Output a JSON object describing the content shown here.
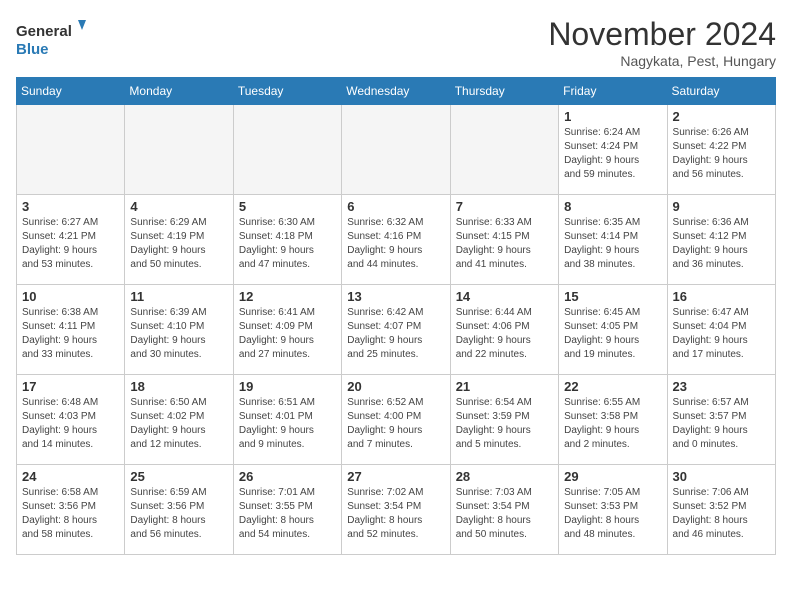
{
  "logo": {
    "line1": "General",
    "line2": "Blue"
  },
  "title": "November 2024",
  "subtitle": "Nagykata, Pest, Hungary",
  "days_of_week": [
    "Sunday",
    "Monday",
    "Tuesday",
    "Wednesday",
    "Thursday",
    "Friday",
    "Saturday"
  ],
  "weeks": [
    [
      {
        "day": "",
        "info": ""
      },
      {
        "day": "",
        "info": ""
      },
      {
        "day": "",
        "info": ""
      },
      {
        "day": "",
        "info": ""
      },
      {
        "day": "",
        "info": ""
      },
      {
        "day": "1",
        "info": "Sunrise: 6:24 AM\nSunset: 4:24 PM\nDaylight: 9 hours\nand 59 minutes."
      },
      {
        "day": "2",
        "info": "Sunrise: 6:26 AM\nSunset: 4:22 PM\nDaylight: 9 hours\nand 56 minutes."
      }
    ],
    [
      {
        "day": "3",
        "info": "Sunrise: 6:27 AM\nSunset: 4:21 PM\nDaylight: 9 hours\nand 53 minutes."
      },
      {
        "day": "4",
        "info": "Sunrise: 6:29 AM\nSunset: 4:19 PM\nDaylight: 9 hours\nand 50 minutes."
      },
      {
        "day": "5",
        "info": "Sunrise: 6:30 AM\nSunset: 4:18 PM\nDaylight: 9 hours\nand 47 minutes."
      },
      {
        "day": "6",
        "info": "Sunrise: 6:32 AM\nSunset: 4:16 PM\nDaylight: 9 hours\nand 44 minutes."
      },
      {
        "day": "7",
        "info": "Sunrise: 6:33 AM\nSunset: 4:15 PM\nDaylight: 9 hours\nand 41 minutes."
      },
      {
        "day": "8",
        "info": "Sunrise: 6:35 AM\nSunset: 4:14 PM\nDaylight: 9 hours\nand 38 minutes."
      },
      {
        "day": "9",
        "info": "Sunrise: 6:36 AM\nSunset: 4:12 PM\nDaylight: 9 hours\nand 36 minutes."
      }
    ],
    [
      {
        "day": "10",
        "info": "Sunrise: 6:38 AM\nSunset: 4:11 PM\nDaylight: 9 hours\nand 33 minutes."
      },
      {
        "day": "11",
        "info": "Sunrise: 6:39 AM\nSunset: 4:10 PM\nDaylight: 9 hours\nand 30 minutes."
      },
      {
        "day": "12",
        "info": "Sunrise: 6:41 AM\nSunset: 4:09 PM\nDaylight: 9 hours\nand 27 minutes."
      },
      {
        "day": "13",
        "info": "Sunrise: 6:42 AM\nSunset: 4:07 PM\nDaylight: 9 hours\nand 25 minutes."
      },
      {
        "day": "14",
        "info": "Sunrise: 6:44 AM\nSunset: 4:06 PM\nDaylight: 9 hours\nand 22 minutes."
      },
      {
        "day": "15",
        "info": "Sunrise: 6:45 AM\nSunset: 4:05 PM\nDaylight: 9 hours\nand 19 minutes."
      },
      {
        "day": "16",
        "info": "Sunrise: 6:47 AM\nSunset: 4:04 PM\nDaylight: 9 hours\nand 17 minutes."
      }
    ],
    [
      {
        "day": "17",
        "info": "Sunrise: 6:48 AM\nSunset: 4:03 PM\nDaylight: 9 hours\nand 14 minutes."
      },
      {
        "day": "18",
        "info": "Sunrise: 6:50 AM\nSunset: 4:02 PM\nDaylight: 9 hours\nand 12 minutes."
      },
      {
        "day": "19",
        "info": "Sunrise: 6:51 AM\nSunset: 4:01 PM\nDaylight: 9 hours\nand 9 minutes."
      },
      {
        "day": "20",
        "info": "Sunrise: 6:52 AM\nSunset: 4:00 PM\nDaylight: 9 hours\nand 7 minutes."
      },
      {
        "day": "21",
        "info": "Sunrise: 6:54 AM\nSunset: 3:59 PM\nDaylight: 9 hours\nand 5 minutes."
      },
      {
        "day": "22",
        "info": "Sunrise: 6:55 AM\nSunset: 3:58 PM\nDaylight: 9 hours\nand 2 minutes."
      },
      {
        "day": "23",
        "info": "Sunrise: 6:57 AM\nSunset: 3:57 PM\nDaylight: 9 hours\nand 0 minutes."
      }
    ],
    [
      {
        "day": "24",
        "info": "Sunrise: 6:58 AM\nSunset: 3:56 PM\nDaylight: 8 hours\nand 58 minutes."
      },
      {
        "day": "25",
        "info": "Sunrise: 6:59 AM\nSunset: 3:56 PM\nDaylight: 8 hours\nand 56 minutes."
      },
      {
        "day": "26",
        "info": "Sunrise: 7:01 AM\nSunset: 3:55 PM\nDaylight: 8 hours\nand 54 minutes."
      },
      {
        "day": "27",
        "info": "Sunrise: 7:02 AM\nSunset: 3:54 PM\nDaylight: 8 hours\nand 52 minutes."
      },
      {
        "day": "28",
        "info": "Sunrise: 7:03 AM\nSunset: 3:54 PM\nDaylight: 8 hours\nand 50 minutes."
      },
      {
        "day": "29",
        "info": "Sunrise: 7:05 AM\nSunset: 3:53 PM\nDaylight: 8 hours\nand 48 minutes."
      },
      {
        "day": "30",
        "info": "Sunrise: 7:06 AM\nSunset: 3:52 PM\nDaylight: 8 hours\nand 46 minutes."
      }
    ]
  ]
}
